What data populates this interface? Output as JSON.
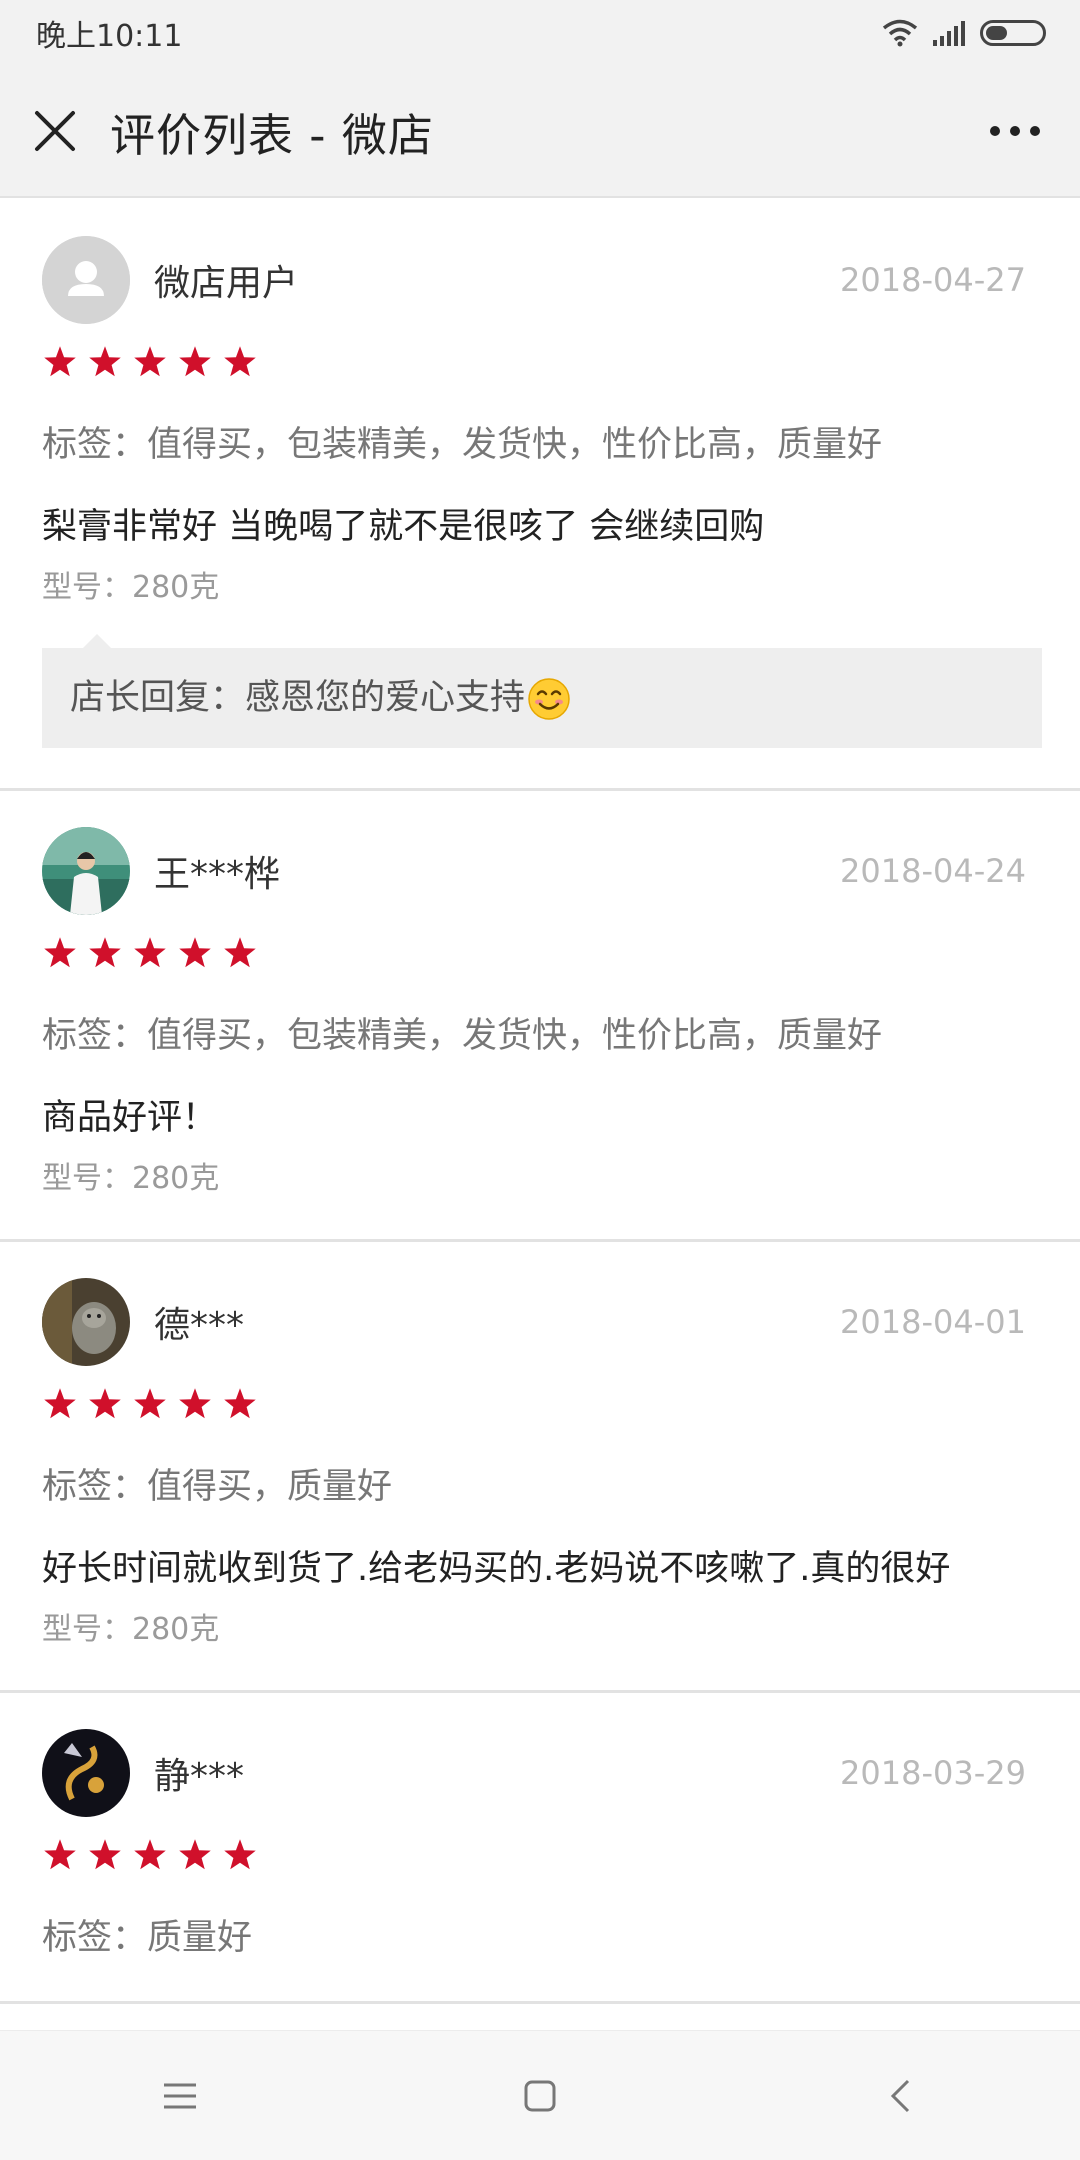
{
  "status_bar": {
    "time": "晚上10:11"
  },
  "header": {
    "title": "评价列表 - 微店"
  },
  "reviews": [
    {
      "name": "微店用户",
      "date": "2018-04-27",
      "rating": 5,
      "tags": "标签：值得买，包装精美，发货快，性价比高，质量好",
      "content": "梨膏非常好 当晚喝了就不是很咳了 会继续回购",
      "model": "型号：280克",
      "reply": "店长回复：感恩您的爱心支持"
    },
    {
      "name": "王***桦",
      "date": "2018-04-24",
      "rating": 5,
      "tags": "标签：值得买，包装精美，发货快，性价比高，质量好",
      "content": "商品好评！",
      "model": "型号：280克"
    },
    {
      "name": "德***",
      "date": "2018-04-01",
      "rating": 5,
      "tags": "标签：值得买，质量好",
      "content": "好长时间就收到货了.给老妈买的.老妈说不咳嗽了.真的很好",
      "model": "型号：280克"
    },
    {
      "name": "静***",
      "date": "2018-03-29",
      "rating": 5,
      "tags": "标签：质量好"
    }
  ],
  "colors": {
    "star": "#d0102b",
    "header_bg": "#f2f2f2"
  },
  "icons": {
    "close": "close-icon",
    "more": "more-icon",
    "menu": "menu-icon",
    "home": "home-icon",
    "back": "back-icon"
  }
}
